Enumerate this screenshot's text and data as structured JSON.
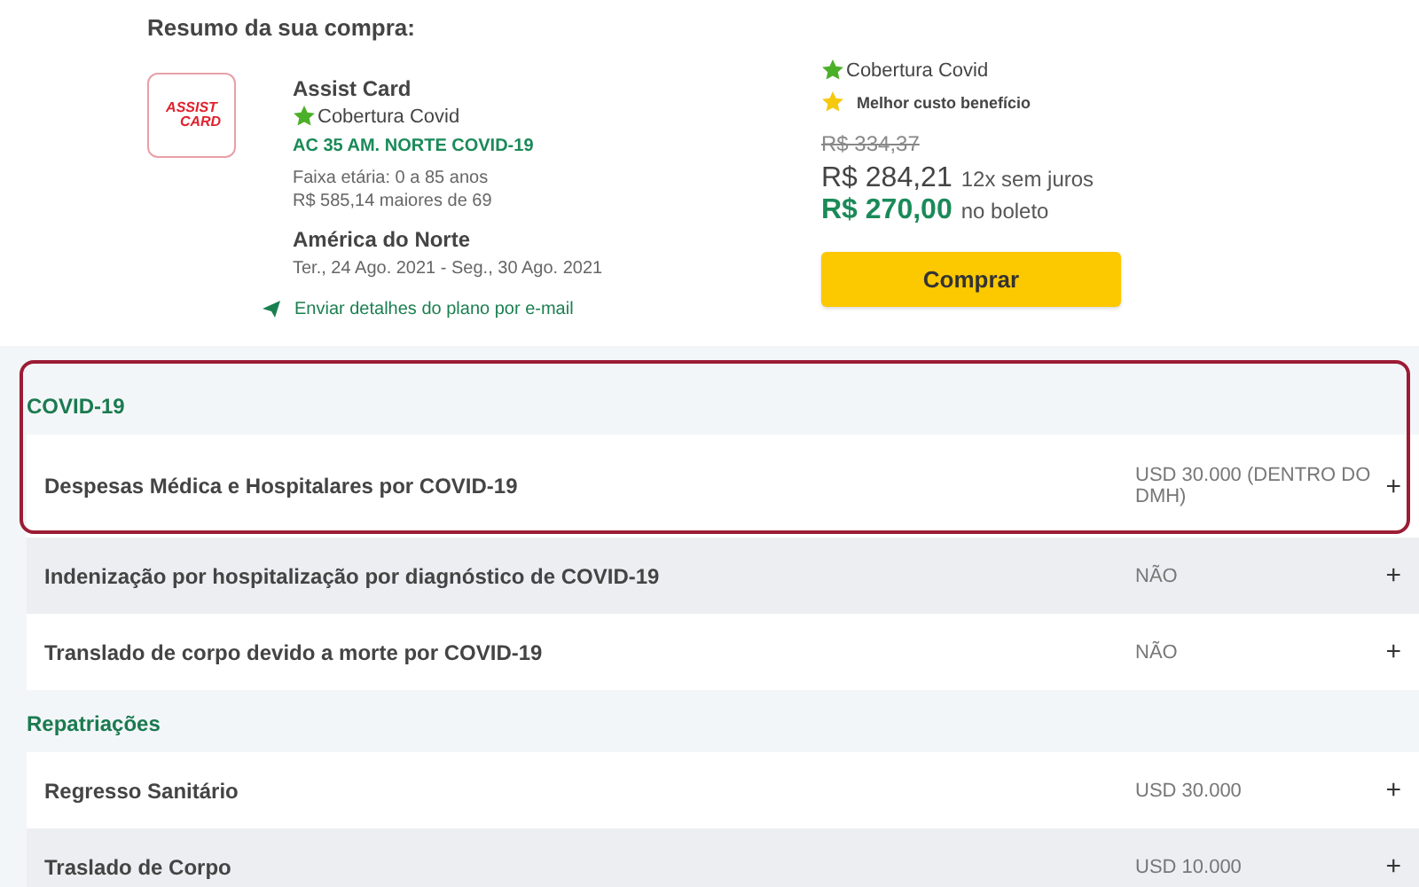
{
  "summary": {
    "title": "Resumo da sua compra:",
    "logo": {
      "line_1": "ASSIST",
      "line_2": "CARD"
    },
    "provider": "Assist Card",
    "coverage_badge": "Cobertura Covid",
    "plan": "AC 35 AM. NORTE COVID-19",
    "age_range": "Faixa etária: 0 a 85 anos",
    "senior_price": "R$ 585,14 maiores de 69",
    "destination": "América do Norte",
    "dates": "Ter., 24 Ago. 2021 - Seg., 30 Ago. 2021",
    "email_link": "Enviar detalhes do plano por e-mail"
  },
  "pricing": {
    "badges": [
      {
        "text": "Cobertura Covid",
        "kind": "covid"
      },
      {
        "text": "Melhor custo benefício",
        "kind": "best"
      }
    ],
    "old_price": "R$ 334,37",
    "installment_price": "R$ 284,21",
    "installment_note": "12x sem juros",
    "boleto_price": "R$ 270,00",
    "boleto_note": "no boleto",
    "buy_button": "Comprar"
  },
  "sections": [
    {
      "title": "COVID-19",
      "highlighted": true,
      "rows": [
        {
          "label": "Despesas Médica e Hospitalares por COVID-19",
          "value": "USD 30.000 (DENTRO DO DMH)",
          "expand": "+"
        },
        {
          "label": "Indenização por hospitalização por diagnóstico de COVID-19",
          "value": "NÃO",
          "expand": "+"
        },
        {
          "label": "Translado de corpo devido a morte por COVID-19",
          "value": "NÃO",
          "expand": "+"
        }
      ]
    },
    {
      "title": "Repatriações",
      "highlighted": false,
      "rows": [
        {
          "label": "Regresso Sanitário",
          "value": "USD 30.000",
          "expand": "+"
        },
        {
          "label": "Traslado de Corpo",
          "value": "USD 10.000",
          "expand": "+"
        }
      ]
    }
  ]
}
